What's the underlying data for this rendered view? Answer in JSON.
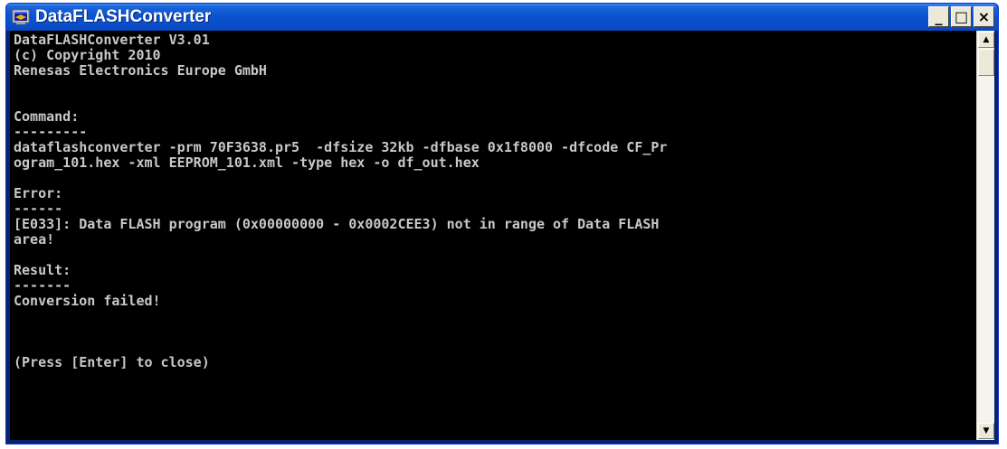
{
  "window": {
    "title": "DataFLASHConverter",
    "icon": "dos-console-icon",
    "controls": {
      "minimize": "_",
      "maximize": "□",
      "close": "×"
    }
  },
  "console": {
    "lines": [
      "DataFLASHConverter V3.01",
      "(c) Copyright 2010",
      "Renesas Electronics Europe GmbH",
      "",
      "",
      "Command:",
      "---------",
      "dataflashconverter -prm 70F3638.pr5  -dfsize 32kb -dfbase 0x1f8000 -dfcode CF_Pr",
      "ogram_101.hex -xml EEPROM_101.xml -type hex -o df_out.hex",
      "",
      "Error:",
      "------",
      "[E033]: Data FLASH program (0x00000000 - 0x0002CEE3) not in range of Data FLASH",
      "area!",
      "",
      "Result:",
      "-------",
      "Conversion failed!",
      "",
      "",
      "",
      "(Press [Enter] to close)"
    ]
  },
  "scrollbar": {
    "up_arrow": "▲",
    "down_arrow": "▼"
  },
  "colors": {
    "titlebar": "#0a52d3",
    "console_bg": "#000000",
    "console_text": "#c8c8c8"
  }
}
